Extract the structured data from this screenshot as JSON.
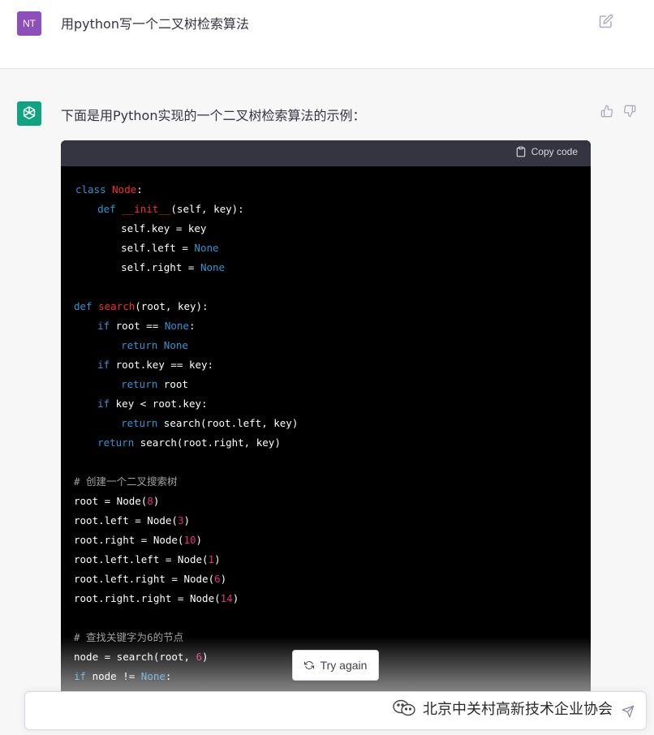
{
  "user_message": {
    "avatar_initials": "NT",
    "text": "用python写一个二叉树检索算法"
  },
  "assistant_message": {
    "intro": "下面是用Python实现的一个二叉树检索算法的示例：",
    "copy_label": "Copy code",
    "code_lines": [
      [
        {
          "t": "class ",
          "c": "kw"
        },
        {
          "t": "Node",
          "c": "fn"
        },
        {
          "t": ":",
          "c": ""
        }
      ],
      [
        {
          "t": "  ",
          "c": ""
        },
        {
          "t": "def ",
          "c": "kw"
        },
        {
          "t": "__init__",
          "c": "fn"
        },
        {
          "t": "(self, key):",
          "c": ""
        }
      ],
      [
        {
          "t": "    self.key = key",
          "c": ""
        }
      ],
      [
        {
          "t": "    self.left = ",
          "c": ""
        },
        {
          "t": "None",
          "c": "cn"
        }
      ],
      [
        {
          "t": "    self.right = ",
          "c": ""
        },
        {
          "t": "None",
          "c": "cn"
        }
      ],
      [],
      [
        {
          "t": "def ",
          "c": "kw"
        },
        {
          "t": "search",
          "c": "fn"
        },
        {
          "t": "(root, key):",
          "c": ""
        }
      ],
      [
        {
          "t": "  ",
          "c": ""
        },
        {
          "t": "if ",
          "c": "kw"
        },
        {
          "t": "root == ",
          "c": ""
        },
        {
          "t": "None",
          "c": "cn"
        },
        {
          "t": ":",
          "c": ""
        }
      ],
      [
        {
          "t": "    ",
          "c": ""
        },
        {
          "t": "return ",
          "c": "kw"
        },
        {
          "t": "None",
          "c": "cn"
        }
      ],
      [
        {
          "t": "  ",
          "c": ""
        },
        {
          "t": "if ",
          "c": "kw"
        },
        {
          "t": "root.key == key:",
          "c": ""
        }
      ],
      [
        {
          "t": "    ",
          "c": ""
        },
        {
          "t": "return ",
          "c": "kw"
        },
        {
          "t": "root",
          "c": ""
        }
      ],
      [
        {
          "t": "  ",
          "c": ""
        },
        {
          "t": "if ",
          "c": "kw"
        },
        {
          "t": "key < root.key:",
          "c": ""
        }
      ],
      [
        {
          "t": "    ",
          "c": ""
        },
        {
          "t": "return ",
          "c": "kw"
        },
        {
          "t": "search(root.left, key)",
          "c": ""
        }
      ],
      [
        {
          "t": "  ",
          "c": ""
        },
        {
          "t": "return ",
          "c": "kw"
        },
        {
          "t": "search(root.right, key)",
          "c": ""
        }
      ],
      [],
      [
        {
          "t": "# 创建一个二叉搜索树",
          "c": "cm"
        }
      ],
      [
        {
          "t": "root = Node(",
          "c": ""
        },
        {
          "t": "8",
          "c": "nm"
        },
        {
          "t": ")",
          "c": ""
        }
      ],
      [
        {
          "t": "root.left = Node(",
          "c": ""
        },
        {
          "t": "3",
          "c": "nm"
        },
        {
          "t": ")",
          "c": ""
        }
      ],
      [
        {
          "t": "root.right = Node(",
          "c": ""
        },
        {
          "t": "10",
          "c": "nm"
        },
        {
          "t": ")",
          "c": ""
        }
      ],
      [
        {
          "t": "root.left.left = Node(",
          "c": ""
        },
        {
          "t": "1",
          "c": "nm"
        },
        {
          "t": ")",
          "c": ""
        }
      ],
      [
        {
          "t": "root.left.right = Node(",
          "c": ""
        },
        {
          "t": "6",
          "c": "nm"
        },
        {
          "t": ")",
          "c": ""
        }
      ],
      [
        {
          "t": "root.right.right = Node(",
          "c": ""
        },
        {
          "t": "14",
          "c": "nm"
        },
        {
          "t": ")",
          "c": ""
        }
      ],
      [],
      [
        {
          "t": "# 查找关键字为6的节点",
          "c": "cm"
        }
      ],
      [
        {
          "t": "node = search(root, ",
          "c": ""
        },
        {
          "t": "6",
          "c": "nm"
        },
        {
          "t": ")",
          "c": ""
        }
      ],
      [
        {
          "t": "if ",
          "c": "kw"
        },
        {
          "t": "node != ",
          "c": ""
        },
        {
          "t": "None",
          "c": "cn"
        },
        {
          "t": ":",
          "c": ""
        }
      ]
    ]
  },
  "try_again_label": "Try again",
  "watermark_text": "北京中关村高新技术企业协会",
  "colors": {
    "user_avatar": "#8e4fbd",
    "bot_avatar": "#10a37f",
    "keyword": "#2e95d3",
    "function": "#f22c3d",
    "number": "#df3079",
    "comment": "#a0a0a0"
  },
  "icons": [
    "edit-icon",
    "thumbs-up-icon",
    "thumbs-down-icon",
    "clipboard-icon",
    "refresh-icon",
    "send-icon",
    "wechat-icon",
    "openai-logo-icon"
  ]
}
